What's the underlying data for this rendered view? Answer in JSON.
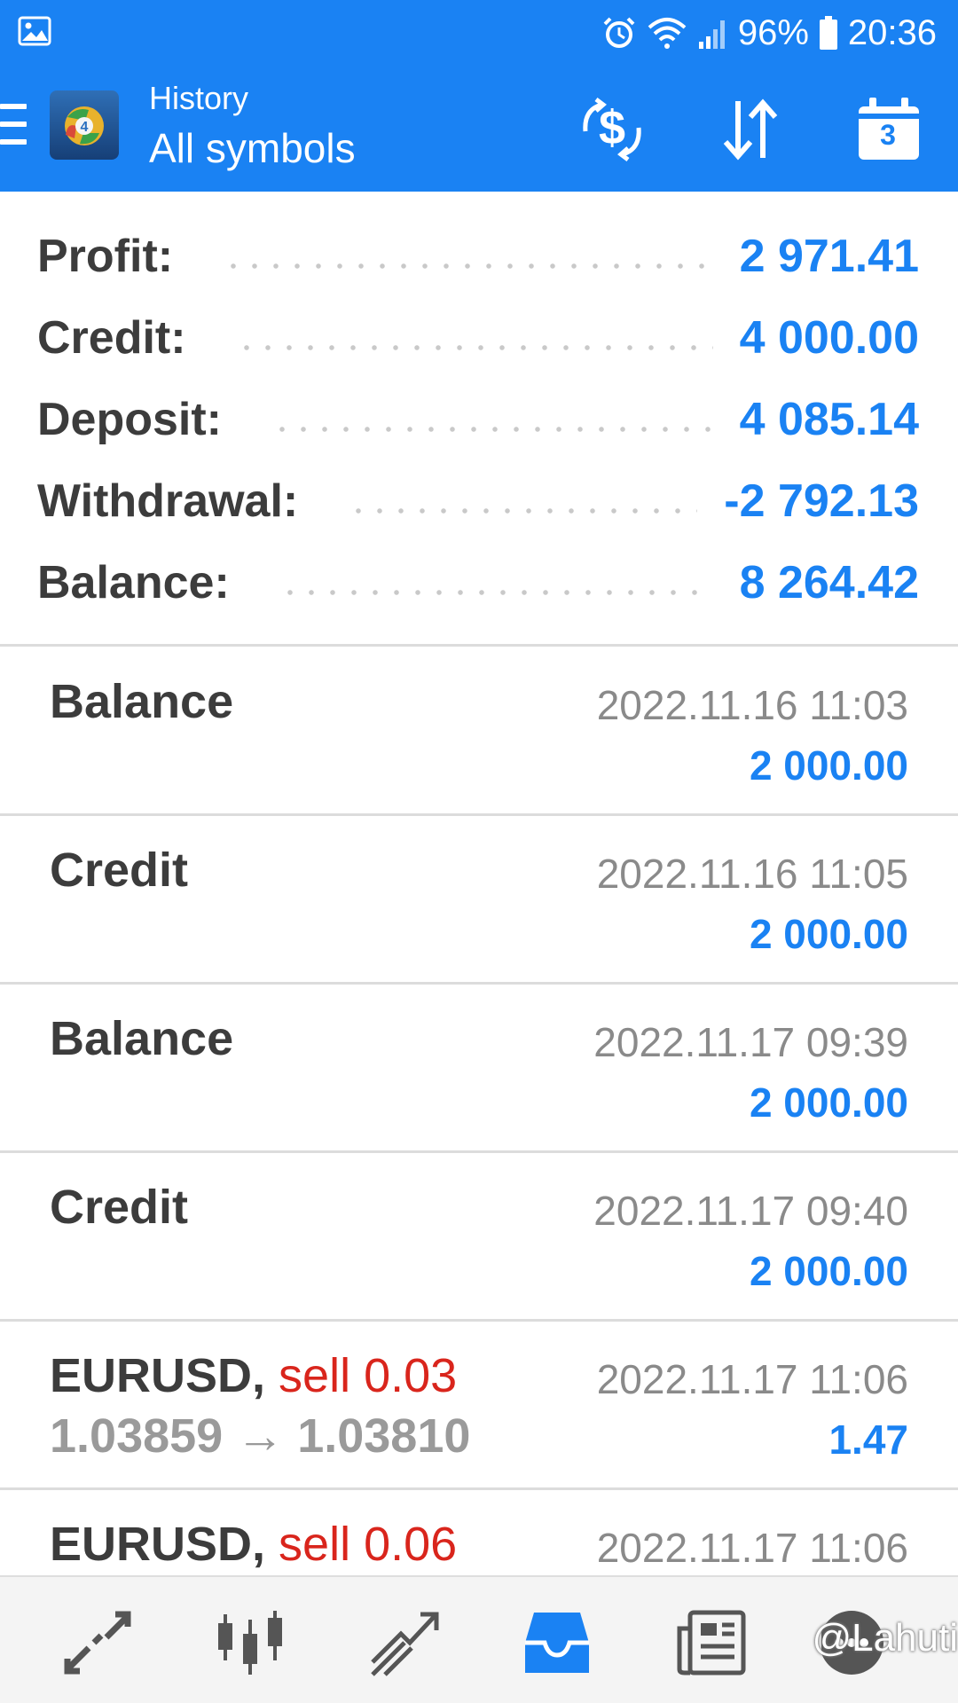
{
  "status_bar": {
    "battery": "96%",
    "time": "20:36",
    "icons": [
      "image-icon",
      "alarm-icon",
      "wifi-icon",
      "signal-icon",
      "battery-icon"
    ]
  },
  "app_bar": {
    "title": "History",
    "subtitle": "All symbols",
    "calendar_day": "3",
    "icons": [
      "menu-icon",
      "app-logo",
      "currency-exchange-icon",
      "sort-icon",
      "calendar-icon"
    ]
  },
  "summary": {
    "profit_label": "Profit:",
    "profit_value": "2 971.41",
    "credit_label": "Credit:",
    "credit_value": "4 000.00",
    "deposit_label": "Deposit:",
    "deposit_value": "4 085.14",
    "withdrawal_label": "Withdrawal:",
    "withdrawal_value": "-2 792.13",
    "balance_label": "Balance:",
    "balance_value": "8 264.42"
  },
  "history": [
    {
      "title": "Balance",
      "time": "2022.11.16 11:03",
      "amount": "2 000.00"
    },
    {
      "title": "Credit",
      "time": "2022.11.16 11:05",
      "amount": "2 000.00"
    },
    {
      "title": "Balance",
      "time": "2022.11.17 09:39",
      "amount": "2 000.00"
    },
    {
      "title": "Credit",
      "time": "2022.11.17 09:40",
      "amount": "2 000.00"
    },
    {
      "symbol": "EURUSD,",
      "side": "sell 0.03",
      "prices": "1.03859 → 1.03810",
      "time": "2022.11.17 11:06",
      "amount": "1.47"
    },
    {
      "symbol": "EURUSD,",
      "side": "sell 0.06",
      "time": "2022.11.17 11:06"
    }
  ],
  "bottom_nav": {
    "items": [
      "quotes-icon",
      "chart-icon",
      "trade-icon",
      "history-icon",
      "news-icon",
      "chat-icon"
    ],
    "active": "history-icon",
    "watermark": "@Lahuti"
  },
  "colors": {
    "primary": "#1a82f3",
    "sell": "#d9251c",
    "text": "#3c3c3c",
    "muted": "#8a8a8a"
  }
}
